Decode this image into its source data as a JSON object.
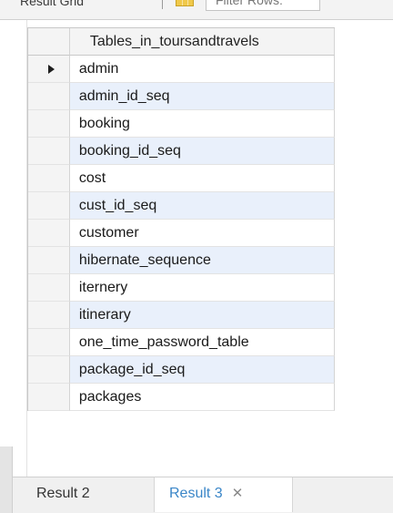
{
  "toolbar": {
    "result_grid_label": "Result Grid",
    "filter_placeholder": "Filter Rows:"
  },
  "grid": {
    "header": "Tables_in_toursandtravels",
    "rows": [
      "admin",
      "admin_id_seq",
      "booking",
      "booking_id_seq",
      "cost",
      "cust_id_seq",
      "customer",
      "hibernate_sequence",
      "iternery",
      "itinerary",
      "one_time_password_table",
      "package_id_seq",
      "packages"
    ],
    "current_row_index": 0
  },
  "tabs": [
    {
      "label": "Result 2",
      "active": false
    },
    {
      "label": "Result 3",
      "active": true,
      "close_icon": "close-icon"
    }
  ],
  "colors": {
    "alt_row": "#e9f0fb",
    "active_tab_text": "#3a86c8"
  }
}
